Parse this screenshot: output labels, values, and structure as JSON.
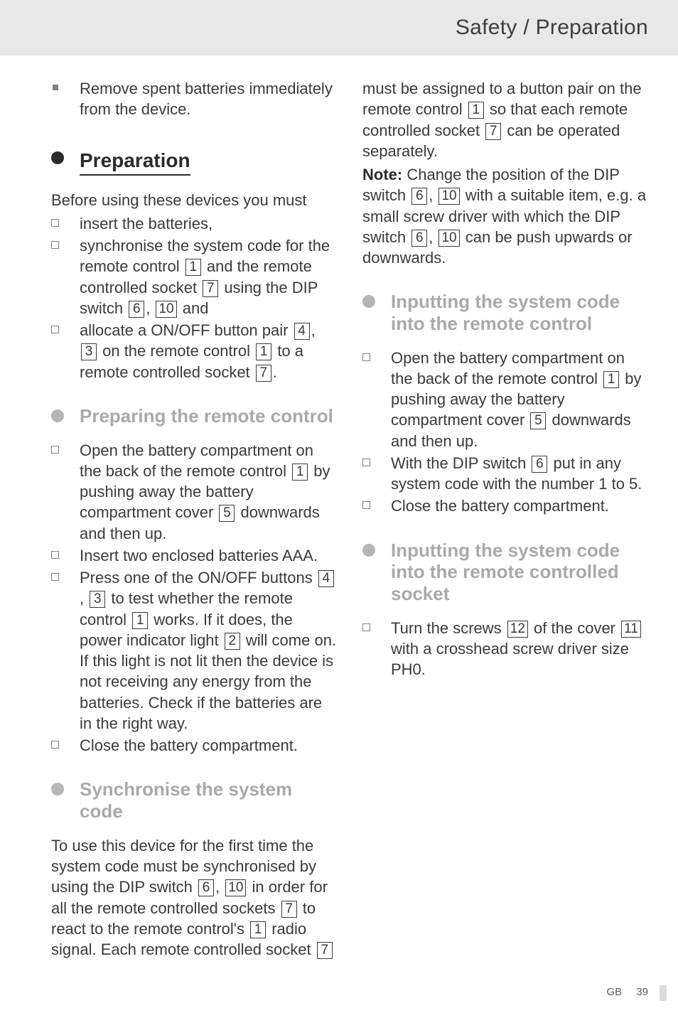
{
  "header": {
    "title": "Safety / Preparation"
  },
  "intro_bullet": "Remove spent batteries immediately from the device.",
  "h_preparation": "Preparation",
  "prep_intro": "Before using these devices you must",
  "prep_items": {
    "a": "insert the batteries,",
    "b1": "synchronise the system code for the remote control ",
    "b2": " and the remote controlled socket ",
    "b3": " using the DIP switch ",
    "b4": " and",
    "c1": "allocate a ON/OFF button pair ",
    "c2": " on the remote control ",
    "c3": " to a remote controlled socket "
  },
  "h_preparing_remote": "Preparing the remote control",
  "pr": {
    "a1": "Open the battery compartment on the back of the remote control ",
    "a2": " by pushing away the battery compartment cover ",
    "a3": " downwards and then up.",
    "b": "Insert two enclosed batteries AAA.",
    "c1": "Press one of the ON/OFF buttons ",
    "c2": " to test whether the remote control ",
    "c3": " works. If it does, the power indicator light ",
    "c4": " will come on. If this light is not lit then the device is not receiving any energy from the batteries. Check if the batteries are in the right way.",
    "d": "Close the battery compartment."
  },
  "h_sync": "Synchronise the system code",
  "sync": {
    "p1a": "To use this device for the first time the system code must be synchronised by using the DIP switch ",
    "p1b": " in order for all the remote controlled sockets ",
    "p1c": " to react to the remote control's ",
    "p1d": " radio signal. Each remote controlled socket ",
    "p1e": " must be assigned to a button pair on the remote control ",
    "p1f": " so that each remote controlled socket ",
    "p1g": " can be operated separately.",
    "note_label": "Note:",
    "p2a": " Change the position of the DIP switch ",
    "p2b": " with a suitable item, e.g. a small screw driver with which the DIP switch ",
    "p2c": " can be push upwards or downwards."
  },
  "h_input_remote": "Inputting the system code into the remote control",
  "ir": {
    "a1": "Open the battery compartment on the back of the remote control ",
    "a2": " by pushing away the battery compartment cover ",
    "a3": " downwards and then up.",
    "b1": "With the DIP switch ",
    "b2": " put in any system code with the number 1 to 5.",
    "c": "Close the battery compartment."
  },
  "h_input_socket": "Inputting the system code into the remote controlled socket",
  "is": {
    "a1": "Turn the screws ",
    "a2": " of the cover ",
    "a3": " with a crosshead screw driver size PH0."
  },
  "nums": {
    "n1": "1",
    "n2": "2",
    "n3": "3",
    "n4": "4",
    "n5": "5",
    "n6": "6",
    "n7": "7",
    "n10": "10",
    "n11": "11",
    "n12": "12"
  },
  "footer": {
    "gb": "GB",
    "page": "39"
  }
}
